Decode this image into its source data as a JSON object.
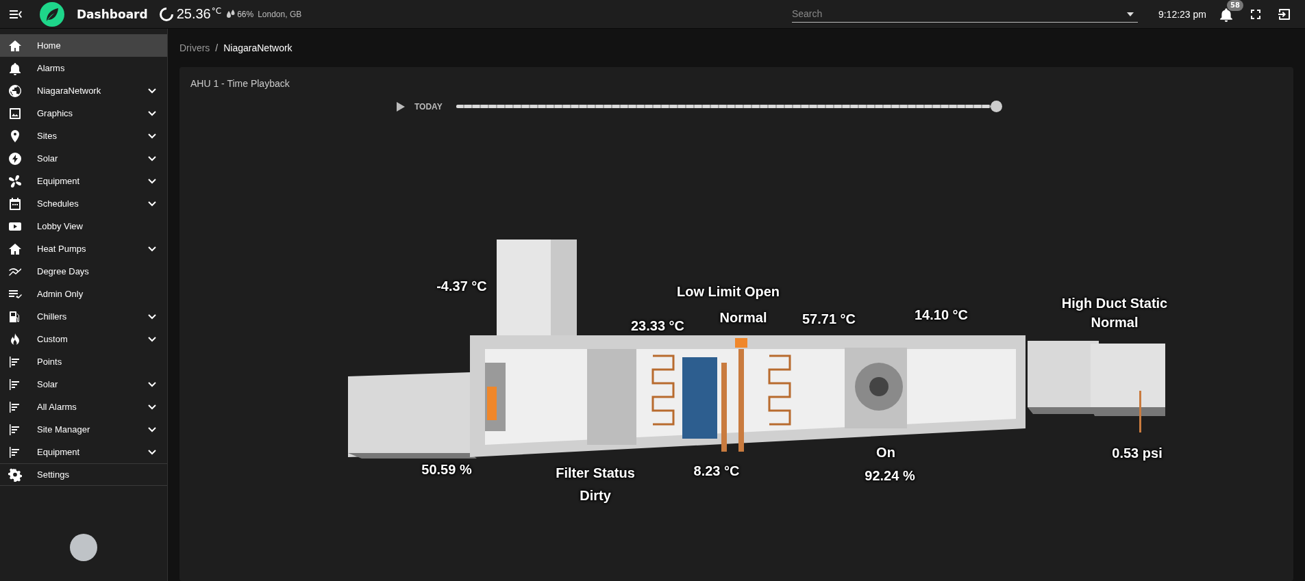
{
  "topbar": {
    "title": "Dashboard",
    "temperature": "25.36",
    "temperature_unit": "°C",
    "humidity": "66%",
    "location": "London, GB",
    "search": {
      "placeholder": "Search"
    },
    "clock": "9:12:23 pm",
    "notifications": "58"
  },
  "sidebar": {
    "items": [
      {
        "label": "Home",
        "expandable": false,
        "selected": true
      },
      {
        "label": "Alarms",
        "expandable": false,
        "selected": false
      },
      {
        "label": "NiagaraNetwork",
        "expandable": true,
        "selected": false
      },
      {
        "label": "Graphics",
        "expandable": true,
        "selected": false
      },
      {
        "label": "Sites",
        "expandable": true,
        "selected": false
      },
      {
        "label": "Solar",
        "expandable": true,
        "selected": false
      },
      {
        "label": "Equipment",
        "expandable": true,
        "selected": false
      },
      {
        "label": "Schedules",
        "expandable": true,
        "selected": false
      },
      {
        "label": "Lobby View",
        "expandable": false,
        "selected": false
      },
      {
        "label": "Heat Pumps",
        "expandable": true,
        "selected": false
      },
      {
        "label": "Degree Days",
        "expandable": false,
        "selected": false
      },
      {
        "label": "Admin Only",
        "expandable": false,
        "selected": false
      },
      {
        "label": "Chillers",
        "expandable": true,
        "selected": false
      },
      {
        "label": "Custom",
        "expandable": true,
        "selected": false
      },
      {
        "label": "Points",
        "expandable": false,
        "selected": false
      },
      {
        "label": "Solar",
        "expandable": true,
        "selected": false
      },
      {
        "label": "All Alarms",
        "expandable": true,
        "selected": false
      },
      {
        "label": "Site Manager",
        "expandable": true,
        "selected": false
      },
      {
        "label": "Equipment",
        "expandable": true,
        "selected": false
      },
      {
        "label": "Settings",
        "expandable": false,
        "selected": false
      }
    ]
  },
  "breadcrumb": {
    "separator": "/",
    "items": [
      {
        "label": "Drivers",
        "current": false
      },
      {
        "label": "NiagaraNetwork",
        "current": true
      }
    ]
  },
  "card": {
    "title": "AHU 1 - Time Playback",
    "playback": {
      "label": "TODAY",
      "level": 1
    },
    "readings": [
      {
        "text": "-4.37 °C"
      },
      {
        "text": "Low Limit Open"
      },
      {
        "text": "Normal"
      },
      {
        "text": "23.33 °C"
      },
      {
        "text": "57.71 °C"
      },
      {
        "text": "14.10 °C"
      },
      {
        "text": "High Duct Static"
      },
      {
        "text": "Normal"
      },
      {
        "text": "50.59 %"
      },
      {
        "text": "Filter Status"
      },
      {
        "text": "Dirty"
      },
      {
        "text": "8.23 °C"
      },
      {
        "text": "On"
      },
      {
        "text": "92.24 %"
      },
      {
        "text": "0.53 psi"
      }
    ]
  }
}
